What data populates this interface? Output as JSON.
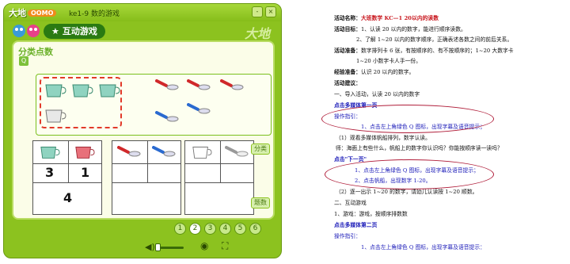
{
  "app": {
    "logo_text": "大地",
    "logo_tag": "OOMO",
    "window_title": "ke1-9  数的游戏",
    "win_buttons": [
      "-",
      "×"
    ],
    "tab_label": "互动游戏",
    "brand": "大地",
    "category_label": "分类点数",
    "category_icon": "Q",
    "numbers": [
      "3",
      "1",
      "4"
    ],
    "side_buttons": {
      "top": "分类",
      "bottom": "题数"
    },
    "pages": [
      "1",
      "2",
      "3",
      "4",
      "5",
      "6"
    ],
    "active_page": "2"
  },
  "doc": {
    "l1_label": "活动名称：",
    "l1_title": "大班数学  KC—1  20以内的读数",
    "l2_label": "活动目标：",
    "l2_text": "1、认读 20 以内的数字，能进行顺序读数。",
    "l3_text": "2、了解 1~20 以内的数字顺序，正确表述各数之间的前后关系。",
    "l4_label": "活动准备：",
    "l4_text": "数字排列卡 6 张，有按顺序的、有不按顺序的；1~20 大数字卡",
    "l5_text": "1~20 小数字卡人手一份。",
    "l6_label": "经验准备：",
    "l6_text": "认识 20 以内的数字。",
    "l7_label": "活动建议：",
    "l8": "一、导入活动，认读 20 以内的数字",
    "l9": "点击多媒体第一页",
    "l10": "操作指引：",
    "l11": "1、点击左上角绿色 Q 图标，出现字幕及语音提示；",
    "l12": "（1）观看多媒体帆船排列，数字认读。",
    "l13": "师：海面上有些什么，帆船上的数字你认识吗？你能按顺序读一读吗？",
    "l14": "点击\"下一页\"",
    "l15": "1、点击左上角绿色 Q 图标，出现字幕及语音提示；",
    "l16": "2、点击帆船，出现数字 1-20。",
    "l17": "（2）逐一出示 1~20 的数字，请幼儿认读按 1~20 顺数。",
    "l18": "二、互动游戏",
    "l19": "1、游戏：游戏，按顺序排数数",
    "l20": "点击多媒体第二页",
    "l21": "操作指引：",
    "l22": "1、点击左上角绿色 Q 图标，出现字幕及语音提示："
  }
}
